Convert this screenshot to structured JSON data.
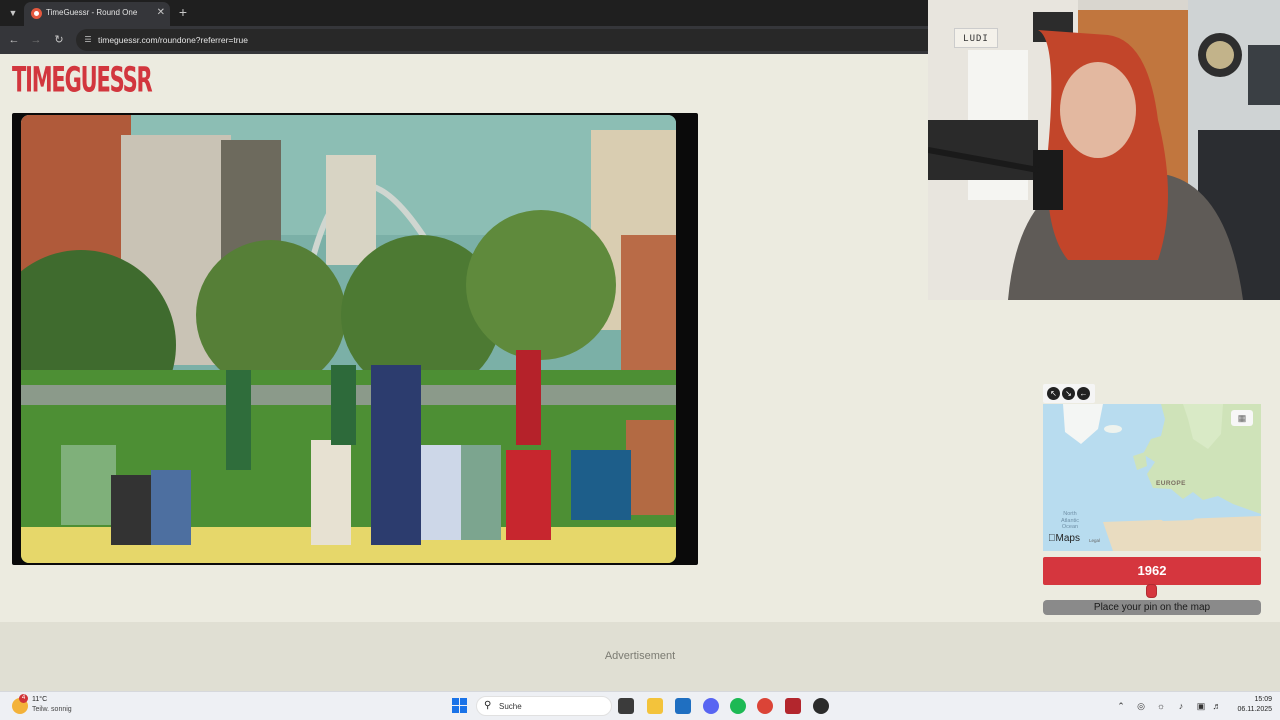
{
  "browser": {
    "tab_title": "TimeGuessr - Round One",
    "url": "timeguessr.com/roundone?referrer=true",
    "new_tab_symbol": "+",
    "close_symbol": "✕"
  },
  "page": {
    "logo_text": "TIMEGUESSR",
    "year": "1962",
    "place_pin_label": "Place your pin on the map",
    "advertisement_label": "Advertisement"
  },
  "map": {
    "region_label": "EUROPE",
    "ocean_label": "North Atlantic Ocean",
    "brand": "Maps",
    "legal": "Legal"
  },
  "webcam": {
    "sign_text": "LUDI"
  },
  "taskbar": {
    "weather_temp": "11°C",
    "weather_desc": "Teilw. sonnig",
    "weather_badge": "4",
    "search_label": "Suche",
    "time": "15:09",
    "date": "06.11.2025"
  },
  "colors": {
    "brand_red": "#d5363e",
    "page_background": "#ecebe0"
  }
}
